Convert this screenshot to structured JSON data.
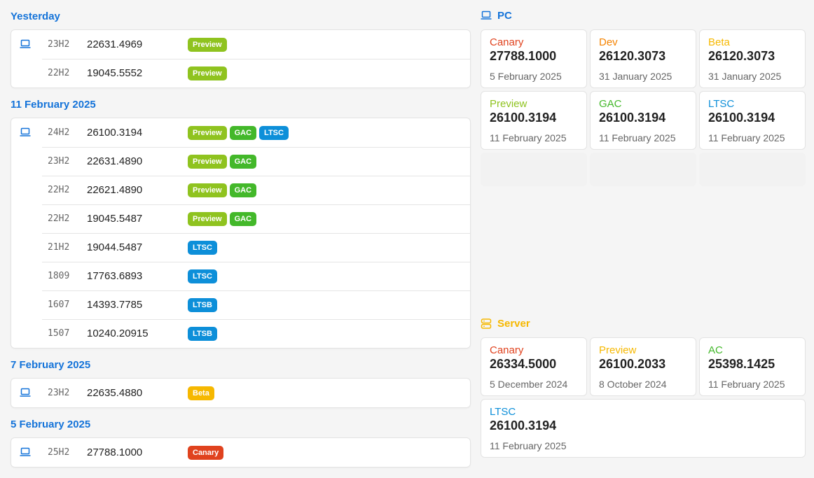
{
  "colors": {
    "group_title": "#1473d9",
    "Preview": "#8fc31f",
    "GAC": "#43b82a",
    "LTSC": "#0d8fd9",
    "LTSB": "#0d8fd9",
    "Beta": "#f6b800",
    "Canary": "#e0421e",
    "Dev": "#f58300",
    "AC": "#43b82a",
    "pc_heading": "#1473d9",
    "server_heading": "#f6b800"
  },
  "groups": [
    {
      "title": "Yesterday",
      "rows": [
        {
          "icon": "laptop-icon",
          "version": "23H2",
          "build": "22631.4969",
          "badges": [
            "Preview"
          ]
        },
        {
          "icon": "",
          "version": "22H2",
          "build": "19045.5552",
          "badges": [
            "Preview"
          ]
        }
      ]
    },
    {
      "title": "11 February 2025",
      "rows": [
        {
          "icon": "laptop-icon",
          "version": "24H2",
          "build": "26100.3194",
          "badges": [
            "Preview",
            "GAC",
            "LTSC"
          ]
        },
        {
          "icon": "",
          "version": "23H2",
          "build": "22631.4890",
          "badges": [
            "Preview",
            "GAC"
          ]
        },
        {
          "icon": "",
          "version": "22H2",
          "build": "22621.4890",
          "badges": [
            "Preview",
            "GAC"
          ]
        },
        {
          "icon": "",
          "version": "22H2",
          "build": "19045.5487",
          "badges": [
            "Preview",
            "GAC"
          ]
        },
        {
          "icon": "",
          "version": "21H2",
          "build": "19044.5487",
          "badges": [
            "LTSC"
          ]
        },
        {
          "icon": "",
          "version": "1809",
          "build": "17763.6893",
          "badges": [
            "LTSC"
          ]
        },
        {
          "icon": "",
          "version": "1607",
          "build": "14393.7785",
          "badges": [
            "LTSB"
          ]
        },
        {
          "icon": "",
          "version": "1507",
          "build": "10240.20915",
          "badges": [
            "LTSB"
          ]
        }
      ]
    },
    {
      "title": "7 February 2025",
      "rows": [
        {
          "icon": "laptop-icon",
          "version": "23H2",
          "build": "22635.4880",
          "badges": [
            "Beta"
          ]
        }
      ]
    },
    {
      "title": "5 February 2025",
      "rows": [
        {
          "icon": "laptop-icon",
          "version": "25H2",
          "build": "27788.1000",
          "badges": [
            "Canary"
          ]
        }
      ]
    }
  ],
  "pc": {
    "heading": "PC",
    "icon": "laptop-icon",
    "tiles": [
      {
        "name": "Canary",
        "color": "#e0421e",
        "build": "27788.1000",
        "date": "5 February 2025"
      },
      {
        "name": "Dev",
        "color": "#f58300",
        "build": "26120.3073",
        "date": "31 January 2025"
      },
      {
        "name": "Beta",
        "color": "#f6b800",
        "build": "26120.3073",
        "date": "31 January 2025"
      },
      {
        "name": "Preview",
        "color": "#8fc31f",
        "build": "26100.3194",
        "date": "11 February 2025"
      },
      {
        "name": "GAC",
        "color": "#43b82a",
        "build": "26100.3194",
        "date": "11 February 2025"
      },
      {
        "name": "LTSC",
        "color": "#0d8fd9",
        "build": "26100.3194",
        "date": "11 February 2025"
      }
    ]
  },
  "server": {
    "heading": "Server",
    "icon": "server-icon",
    "tiles": [
      {
        "name": "Canary",
        "color": "#e0421e",
        "build": "26334.5000",
        "date": "5 December 2024"
      },
      {
        "name": "Preview",
        "color": "#f6b800",
        "build": "26100.2033",
        "date": "8 October 2024"
      },
      {
        "name": "AC",
        "color": "#43b82a",
        "build": "25398.1425",
        "date": "11 February 2025"
      },
      {
        "name": "LTSC",
        "color": "#0d8fd9",
        "build": "26100.3194",
        "date": "11 February 2025"
      }
    ]
  }
}
